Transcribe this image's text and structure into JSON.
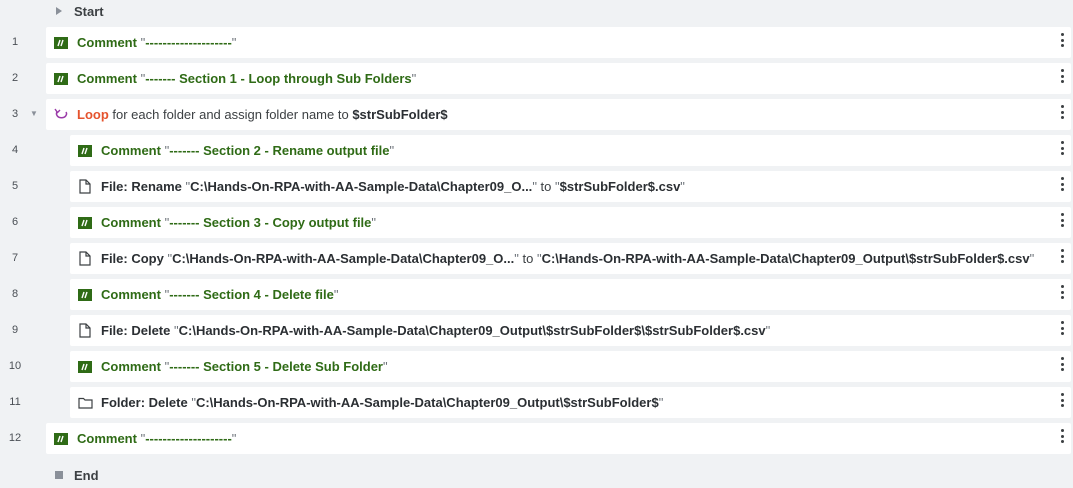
{
  "start_label": "Start",
  "end_label": "End",
  "lines": [
    {
      "num": "1",
      "kw": "Comment",
      "parts": [
        {
          "t": "\"",
          "c": "q"
        },
        {
          "t": "--------------------",
          "c": "val-comment"
        },
        {
          "t": "\"",
          "c": "q"
        }
      ],
      "icon": "comment-icon"
    },
    {
      "num": "2",
      "kw": "Comment",
      "parts": [
        {
          "t": "\"",
          "c": "q"
        },
        {
          "t": "------- Section 1 - Loop through Sub Folders",
          "c": "val-comment"
        },
        {
          "t": "\"",
          "c": "q"
        }
      ],
      "icon": "comment-icon"
    },
    {
      "num": "3",
      "kw": "Loop",
      "parts": [
        {
          "t": " for each folder and assign folder name to ",
          "c": "plain"
        },
        {
          "t": "$strSubFolder$",
          "c": "bold"
        }
      ],
      "icon": "loop-icon"
    },
    {
      "num": "4",
      "kw": "Comment",
      "parts": [
        {
          "t": "\"",
          "c": "q"
        },
        {
          "t": "------- Section 2 - Rename output file",
          "c": "val-comment"
        },
        {
          "t": "\"",
          "c": "q"
        }
      ],
      "icon": "comment-icon"
    },
    {
      "num": "5",
      "kw": "File: Rename",
      "parts": [
        {
          "t": "\"",
          "c": "q"
        },
        {
          "t": "C:\\Hands-On-RPA-with-AA-Sample-Data\\Chapter09_O...",
          "c": "bold"
        },
        {
          "t": "\" ",
          "c": "q"
        },
        {
          "t": "to ",
          "c": "plain"
        },
        {
          "t": "\"",
          "c": "q"
        },
        {
          "t": "$strSubFolder$.csv",
          "c": "bold"
        },
        {
          "t": "\"",
          "c": "q"
        }
      ],
      "icon": "file-icon"
    },
    {
      "num": "6",
      "kw": "Comment",
      "parts": [
        {
          "t": "\"",
          "c": "q"
        },
        {
          "t": "------- Section 3 - Copy output file",
          "c": "val-comment"
        },
        {
          "t": "\"",
          "c": "q"
        }
      ],
      "icon": "comment-icon"
    },
    {
      "num": "7",
      "kw": "File: Copy",
      "parts": [
        {
          "t": "\"",
          "c": "q"
        },
        {
          "t": "C:\\Hands-On-RPA-with-AA-Sample-Data\\Chapter09_O...",
          "c": "bold"
        },
        {
          "t": "\" ",
          "c": "q"
        },
        {
          "t": "to ",
          "c": "plain"
        },
        {
          "t": "\"",
          "c": "q"
        },
        {
          "t": "C:\\Hands-On-RPA-with-AA-Sample-Data\\Chapter09_Output\\$strSubFolder$.csv",
          "c": "bold"
        },
        {
          "t": "\"",
          "c": "q"
        }
      ],
      "icon": "file-icon"
    },
    {
      "num": "8",
      "kw": "Comment",
      "parts": [
        {
          "t": "\"",
          "c": "q"
        },
        {
          "t": "------- Section 4 - Delete file",
          "c": "val-comment"
        },
        {
          "t": "\"",
          "c": "q"
        }
      ],
      "icon": "comment-icon"
    },
    {
      "num": "9",
      "kw": "File: Delete",
      "parts": [
        {
          "t": "\"",
          "c": "q"
        },
        {
          "t": "C:\\Hands-On-RPA-with-AA-Sample-Data\\Chapter09_Output\\$strSubFolder$\\$strSubFolder$.csv",
          "c": "bold"
        },
        {
          "t": "\"",
          "c": "q"
        }
      ],
      "icon": "file-icon"
    },
    {
      "num": "10",
      "kw": "Comment",
      "parts": [
        {
          "t": "\"",
          "c": "q"
        },
        {
          "t": "------- Section 5 - Delete Sub Folder",
          "c": "val-comment"
        },
        {
          "t": "\"",
          "c": "q"
        }
      ],
      "icon": "comment-icon"
    },
    {
      "num": "11",
      "kw": "Folder: Delete",
      "parts": [
        {
          "t": "\"",
          "c": "q"
        },
        {
          "t": "C:\\Hands-On-RPA-with-AA-Sample-Data\\Chapter09_Output\\$strSubFolder$",
          "c": "bold"
        },
        {
          "t": "\"",
          "c": "q"
        }
      ],
      "icon": "folder-icon"
    },
    {
      "num": "12",
      "kw": "Comment",
      "parts": [
        {
          "t": "\"",
          "c": "q"
        },
        {
          "t": "--------------------",
          "c": "val-comment"
        },
        {
          "t": "\"",
          "c": "q"
        }
      ],
      "icon": "comment-icon"
    }
  ]
}
